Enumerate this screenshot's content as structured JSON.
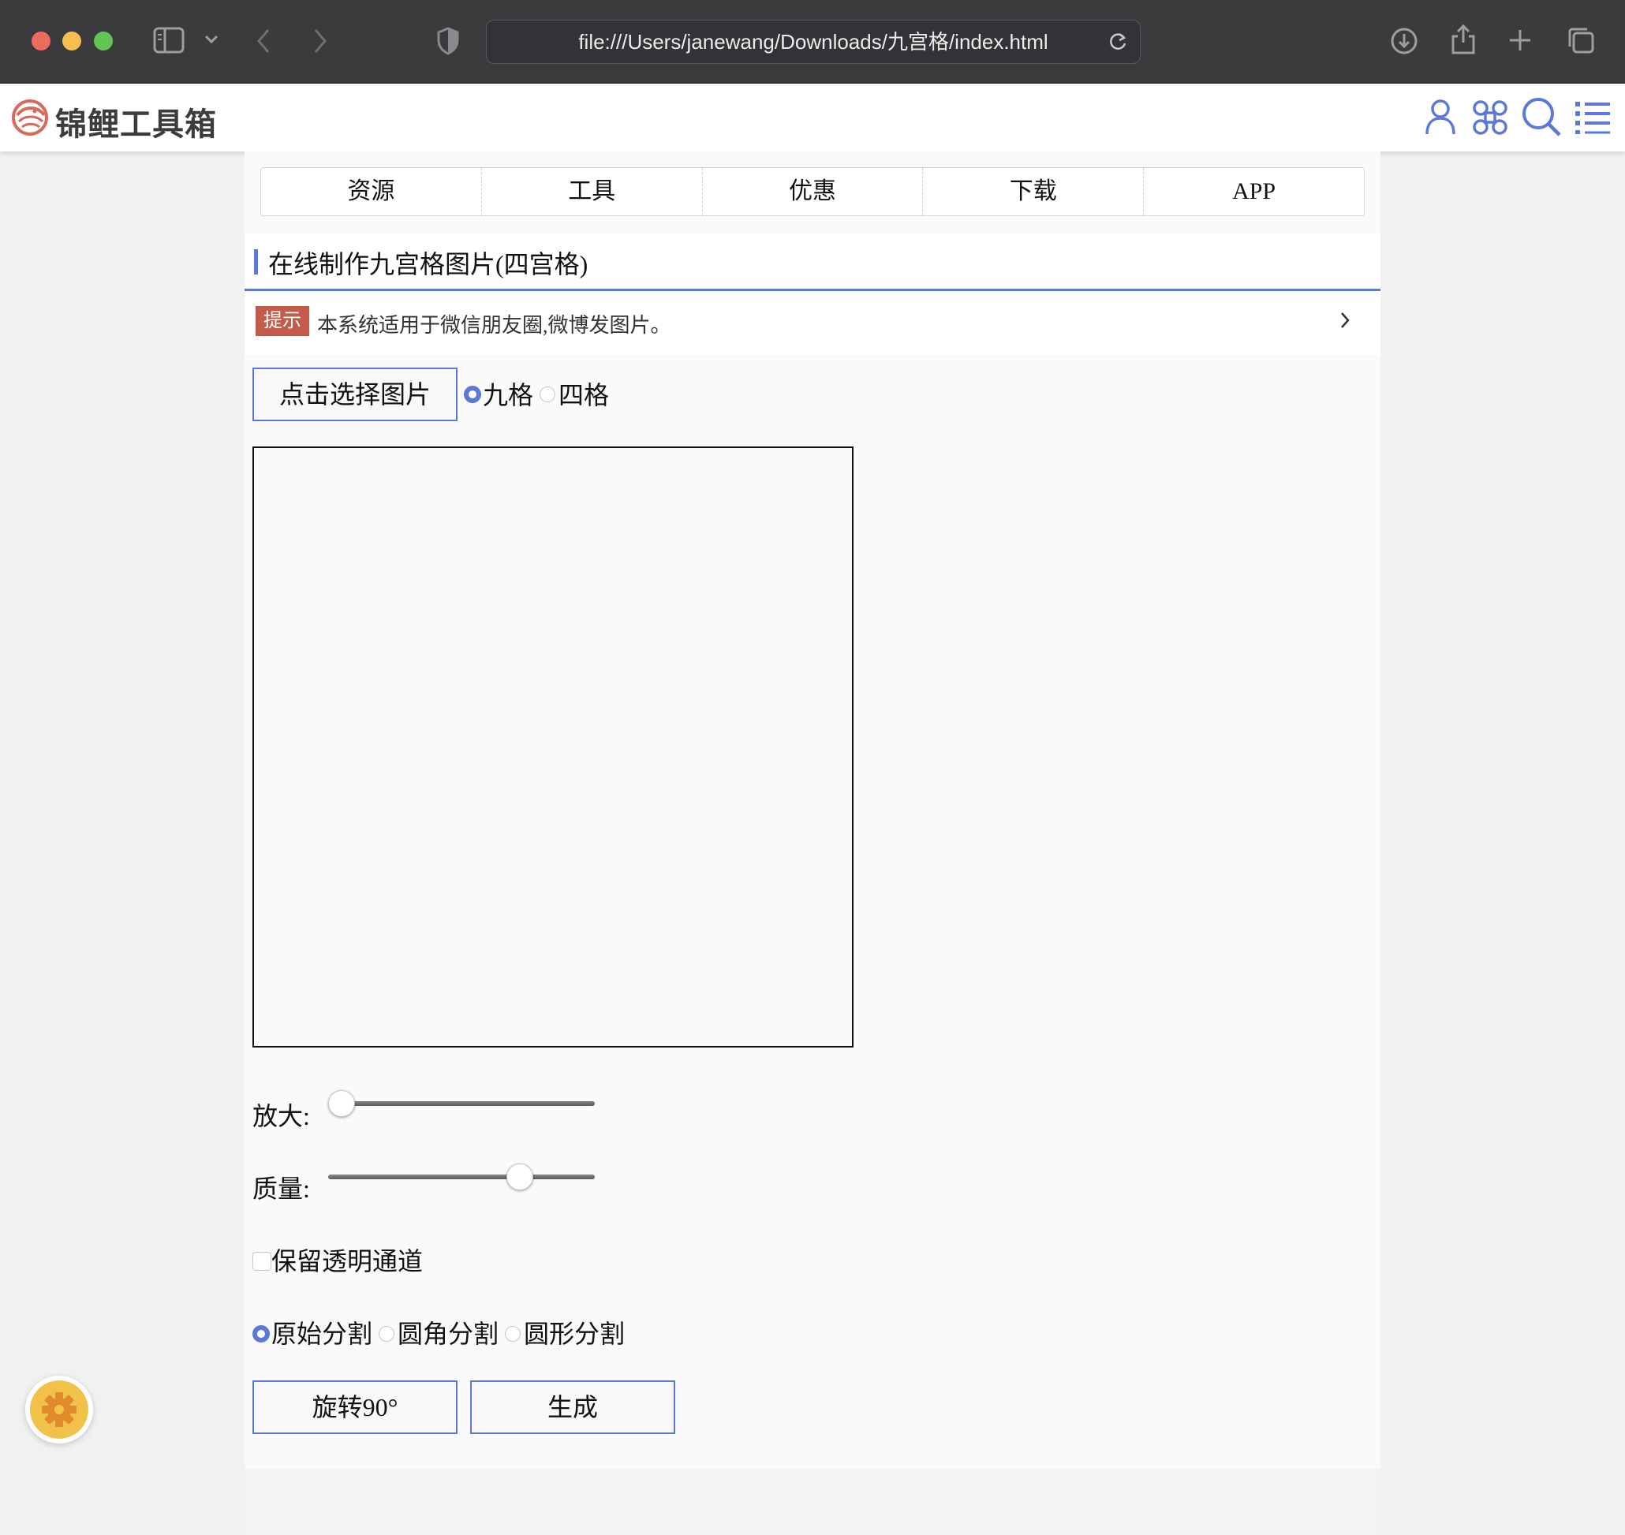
{
  "browser": {
    "url": "file:///Users/janewang/Downloads/九宫格/index.html"
  },
  "site": {
    "logo_text": "锦鲤工具箱",
    "accent_color": "#5b79d8"
  },
  "tabs": [
    {
      "label": "资源"
    },
    {
      "label": "工具"
    },
    {
      "label": "优惠"
    },
    {
      "label": "下载"
    },
    {
      "label": "APP"
    }
  ],
  "section": {
    "title": "在线制作九宫格图片(四宫格)"
  },
  "tip": {
    "badge": "提示",
    "text": "本系统适用于微信朋友圈,微博发图片。"
  },
  "controls": {
    "choose_image_label": "点击选择图片",
    "grid_options": [
      {
        "label": "九格",
        "selected": true
      },
      {
        "label": "四格",
        "selected": false
      }
    ],
    "zoom_label": "放大:",
    "zoom_value": 0.05,
    "quality_label": "质量:",
    "quality_value": 0.72,
    "keep_alpha_label": "保留透明通道",
    "keep_alpha_checked": false,
    "split_options": [
      {
        "label": "原始分割",
        "selected": true
      },
      {
        "label": "圆角分割",
        "selected": false
      },
      {
        "label": "圆形分割",
        "selected": false
      }
    ],
    "rotate_label": "旋转90°",
    "generate_label": "生成"
  }
}
